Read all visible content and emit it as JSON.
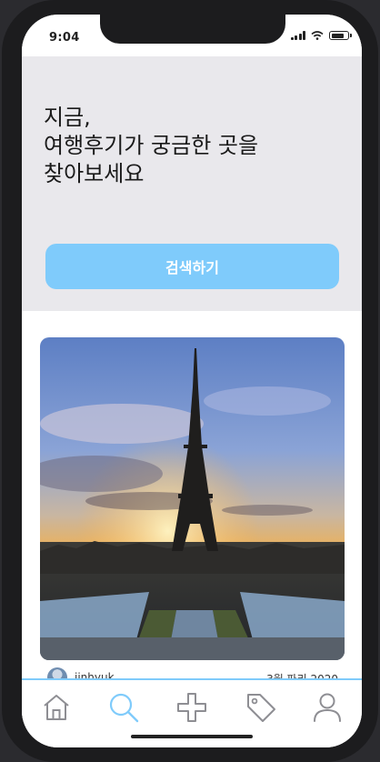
{
  "status_bar": {
    "time": "9:04",
    "battery_level": 0.85
  },
  "hero": {
    "headline_lines": [
      "지금,",
      "여행후기가 궁금한 곳을",
      "찾아보세요"
    ],
    "search_button_label": "검색하기"
  },
  "post": {
    "author": "jinhyuk",
    "date": "3월 파리 2020"
  },
  "tab_bar": {
    "tabs": [
      {
        "name": "home",
        "icon": "home-icon",
        "active": false
      },
      {
        "name": "search",
        "icon": "search-icon",
        "active": true
      },
      {
        "name": "add",
        "icon": "plus-icon",
        "active": false
      },
      {
        "name": "tags",
        "icon": "tag-icon",
        "active": false
      },
      {
        "name": "profile",
        "icon": "user-icon",
        "active": false
      }
    ]
  },
  "colors": {
    "accent": "#7fcbfb",
    "hero_bg": "#e9e8ec",
    "icon_inactive": "#8e8e93"
  }
}
